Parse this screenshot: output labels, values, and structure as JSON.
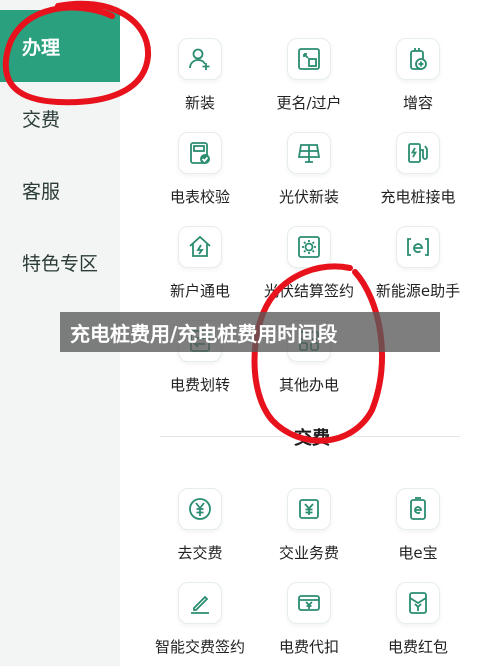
{
  "colors": {
    "accent": "#2aa07e",
    "annotation": "#e8121d",
    "icon": "#2a8c70"
  },
  "sidebar": {
    "items": [
      {
        "label": "办理",
        "active": true
      },
      {
        "label": "交费",
        "active": false
      },
      {
        "label": "客服",
        "active": false
      },
      {
        "label": "特色专区",
        "active": false
      }
    ]
  },
  "services": {
    "items": [
      {
        "label": "新装",
        "icon": "person-add-icon"
      },
      {
        "label": "更名/过户",
        "icon": "transfer-icon"
      },
      {
        "label": "增容",
        "icon": "capacity-add-icon"
      },
      {
        "label": "电表校验",
        "icon": "meter-check-icon"
      },
      {
        "label": "光伏新装",
        "icon": "solar-panel-icon"
      },
      {
        "label": "充电桩接电",
        "icon": "charging-pile-icon"
      },
      {
        "label": "新户通电",
        "icon": "house-power-icon"
      },
      {
        "label": "光伏结算签约",
        "icon": "solar-settle-icon"
      },
      {
        "label": "新能源e助手",
        "icon": "e-assistant-icon"
      },
      {
        "label": "电费划转",
        "icon": "bill-transfer-icon"
      },
      {
        "label": "其他办电",
        "icon": "grid-apps-icon"
      }
    ]
  },
  "payment": {
    "title": "交费",
    "items": [
      {
        "label": "去交费",
        "icon": "yen-coin-icon"
      },
      {
        "label": "交业务费",
        "icon": "yen-doc-icon"
      },
      {
        "label": "电e宝",
        "icon": "e-wallet-icon"
      },
      {
        "label": "智能交费签约",
        "icon": "pen-sign-icon"
      },
      {
        "label": "电费代扣",
        "icon": "card-deduct-icon"
      },
      {
        "label": "电费红包",
        "icon": "red-envelope-icon"
      }
    ]
  },
  "banner": {
    "text": "充电桩费用/充电桩费用时间段"
  }
}
